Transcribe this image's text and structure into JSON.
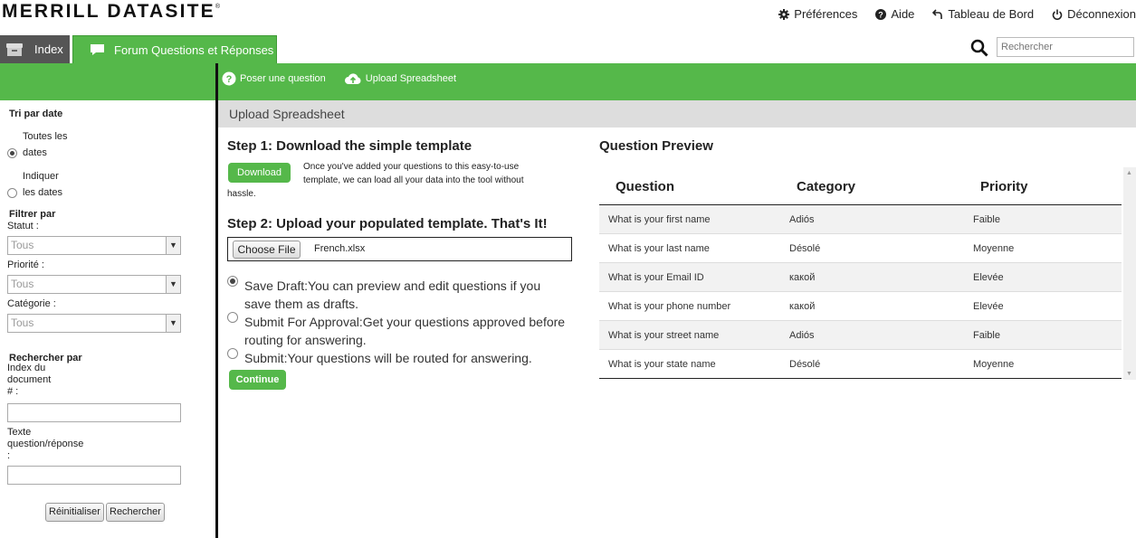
{
  "header": {
    "logo": "MERRILL DATASITE",
    "logo_mark": "®",
    "links": [
      {
        "label": "Préférences",
        "icon": "gear-icon"
      },
      {
        "label": "Aide",
        "icon": "help-icon"
      },
      {
        "label": "Tableau de Bord",
        "icon": "back-arrow-icon"
      },
      {
        "label": "Déconnexion",
        "icon": "power-icon"
      }
    ]
  },
  "tabs": {
    "index": "Index",
    "forum": "Forum Questions et Réponses"
  },
  "search": {
    "placeholder": "Rechercher"
  },
  "actions": {
    "ask": "Poser une question",
    "upload": "Upload Spreadsheet"
  },
  "sidebar": {
    "sort_title": "Tri par date",
    "all_dates_1": "Toutes les",
    "all_dates_2": "dates",
    "indicate_1": "Indiquer",
    "indicate_2": "les dates",
    "filter_title": "Filtrer par",
    "status_label": "Statut :",
    "status_value": "Tous",
    "priority_label": "Priorité :",
    "priority_value": "Tous",
    "category_label": "Catégorie :",
    "category_value": "Tous",
    "search_title": "Rechercher par",
    "doc_index_1": "Index du",
    "doc_index_2": "document",
    "doc_index_3": "# :",
    "qa_text_1": "Texte",
    "qa_text_2": "question/réponse",
    "qa_text_3": ":",
    "reset_btn": "Réinitialiser",
    "search_btn": "Rechercher"
  },
  "panel": {
    "title": "Upload Spreadsheet",
    "step1": "Step 1: Download the simple template",
    "download_btn": "Download",
    "step1_desc_1": "Once you've added your questions to this easy-to-use",
    "step1_desc_2": "template, we can load all your data into the tool without",
    "step1_desc_3": "hassle.",
    "step2": "Step 2: Upload your populated template. That's It!",
    "choose_file": "Choose File",
    "file_name": "French.xlsx",
    "opt1": "Save Draft:You can preview and edit questions if you save them as drafts.",
    "opt2": "Submit For Approval:Get your questions approved before routing for answering.",
    "opt3": "Submit:Your questions will be routed for answering.",
    "continue_btn": "Continue"
  },
  "preview": {
    "title": "Question Preview",
    "columns": [
      "Question",
      "Category",
      "Priority"
    ],
    "rows": [
      [
        "What is your first name",
        "Adiós",
        "Faible"
      ],
      [
        "What is your last name",
        "Désolé",
        "Moyenne"
      ],
      [
        "What is your Email ID",
        "какой",
        "Elevée"
      ],
      [
        "What is your phone number",
        "какой",
        "Elevée"
      ],
      [
        "What is your street name",
        "Adiós",
        "Faible"
      ],
      [
        "What is your state name",
        "Désolé",
        "Moyenne"
      ]
    ]
  }
}
